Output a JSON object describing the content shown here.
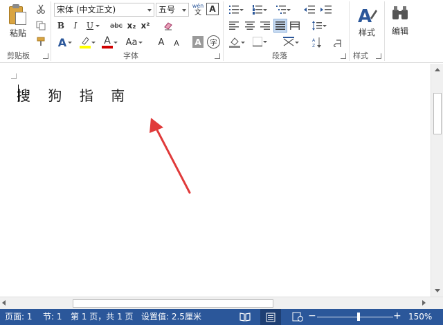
{
  "clipboard": {
    "paste_label": "粘贴",
    "group_label": "剪贴板"
  },
  "font": {
    "family_value": "宋体 (中文正文)",
    "size_value": "五号",
    "pinyin_top": "wén",
    "pinyin_bottom": "文",
    "border_char": "A",
    "bold": "B",
    "italic": "I",
    "underline": "U",
    "strike": "abc",
    "sub": "x₂",
    "sup": "x²",
    "effects": "A",
    "color": "A",
    "case": "Aa",
    "grow": "A",
    "shrink": "A",
    "shade": "A",
    "enclose": "字",
    "group_label": "字体"
  },
  "paragraph": {
    "group_label": "段落"
  },
  "styles": {
    "label": "样式",
    "group_label": "样式"
  },
  "editing": {
    "label": "编辑"
  },
  "document": {
    "text": "搜    狗    指    南"
  },
  "status": {
    "page": "页面: 1",
    "section": "节: 1",
    "page_of": "第 1 页，共 1 页",
    "setting": "设置值: 2.5厘米",
    "zoom": "150%"
  },
  "colors": {
    "status_bg": "#2b579a",
    "arrow": "#e03a3a",
    "highlight": "#ffff00",
    "font_color": "#d00000",
    "accent": "#2b579a"
  }
}
